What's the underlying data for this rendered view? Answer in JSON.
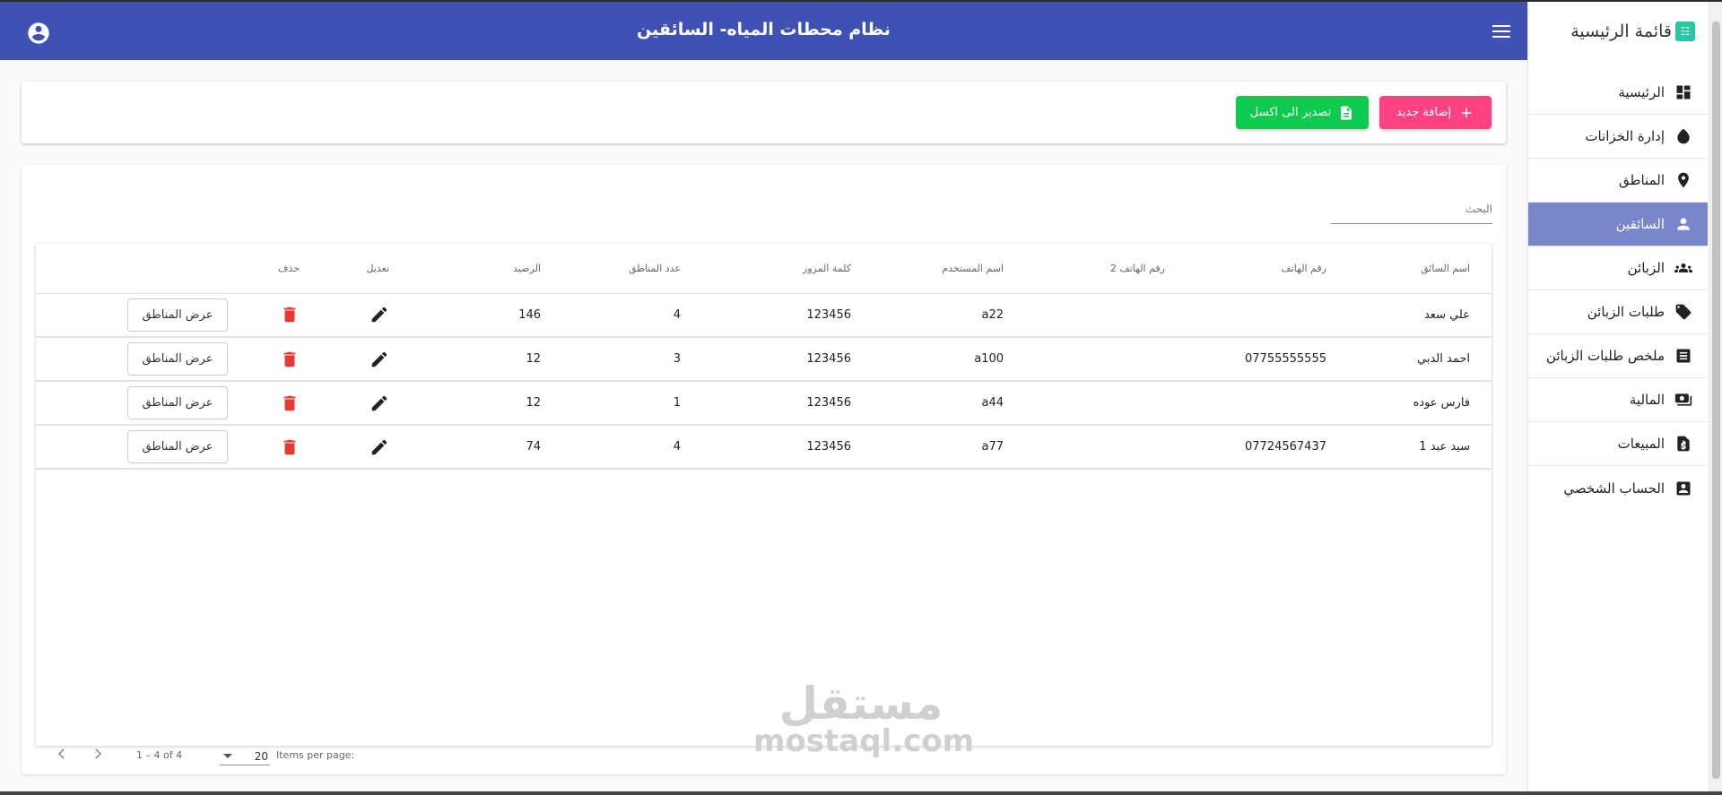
{
  "header": {
    "title": "نظام محطات المياه- السائقين"
  },
  "sidebar": {
    "brand": "قائمة الرئيسية",
    "items": [
      {
        "label": "الرئيسية",
        "icon": "dashboard-icon"
      },
      {
        "label": "إدارة الخزانات",
        "icon": "water-drop-icon"
      },
      {
        "label": "المناطق",
        "icon": "location-pin-icon"
      },
      {
        "label": "السائقين",
        "icon": "person-icon",
        "active": true
      },
      {
        "label": "الزبائن",
        "icon": "people-icon"
      },
      {
        "label": "طلبات الزبائن",
        "icon": "tag-icon"
      },
      {
        "label": "ملخص طلبات الزبائن",
        "icon": "list-icon"
      },
      {
        "label": "المالية",
        "icon": "money-icon"
      },
      {
        "label": "المبيعات",
        "icon": "invoice-icon"
      },
      {
        "label": "الحساب الشخصي",
        "icon": "account-box-icon"
      }
    ]
  },
  "toolbar": {
    "add_label": "إضافة جديد",
    "export_label": "تصدير الى اكسل"
  },
  "search": {
    "placeholder": "البحث"
  },
  "table": {
    "headers": [
      "اسم السائق",
      "رقم الهاتف",
      "رقم الهاتف 2",
      "اسم المستخدم",
      "كلمة المرور",
      "عدد المناطق",
      "الرصيد",
      "تعديل",
      "حذف",
      ""
    ],
    "rows": [
      {
        "name": "علي سعد",
        "phone": "",
        "phone2": "",
        "username": "a22",
        "password": "123456",
        "zones": "4",
        "balance": "146"
      },
      {
        "name": "احمد الدبي",
        "phone": "07755555555",
        "phone2": "",
        "username": "a100",
        "password": "123456",
        "zones": "3",
        "balance": "12"
      },
      {
        "name": "فارس عوده",
        "phone": "",
        "phone2": "",
        "username": "a44",
        "password": "123456",
        "zones": "1",
        "balance": "12"
      },
      {
        "name": "سيد عبد 1",
        "phone": "07724567437",
        "phone2": "",
        "username": "a77",
        "password": "123456",
        "zones": "4",
        "balance": "74"
      }
    ],
    "view_zones_label": "عرض المناطق"
  },
  "paginator": {
    "items_per_page_label": "Items per page:",
    "page_size": "20",
    "range_label": "1 – 4 of 4"
  },
  "watermark": {
    "ar": "مستقل",
    "en": "mostaql.com"
  },
  "colors": {
    "header": "#3f51b5",
    "active_nav": "#7986cb",
    "add_button": "#ff4081",
    "export_button": "#0ecb4f",
    "delete_icon": "#e53935"
  }
}
